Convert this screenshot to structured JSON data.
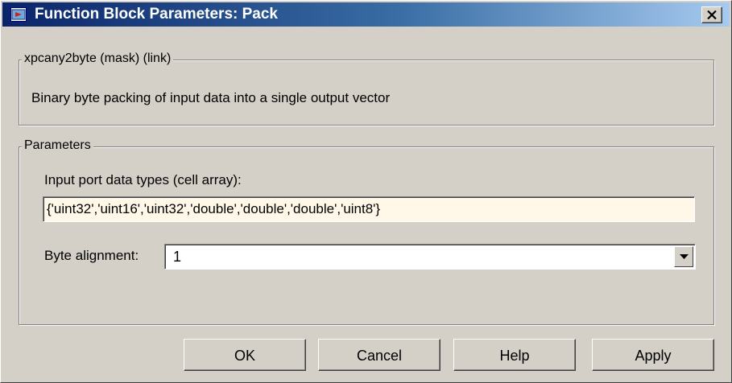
{
  "window": {
    "title": "Function Block Parameters: Pack",
    "close_icon": "close-icon",
    "app_icon": "simulink-block-icon"
  },
  "description_group": {
    "legend": "xpcany2byte (mask) (link)",
    "text": "Binary byte packing of input data into a single output vector"
  },
  "parameters_group": {
    "legend": "Parameters",
    "input_port_label": "Input port data types (cell array):",
    "input_port_value": "{'uint32','uint16','uint32','double','double','double','uint8'}",
    "byte_alignment_label": "Byte alignment:",
    "byte_alignment_value": "1"
  },
  "buttons": {
    "ok": "OK",
    "cancel": "Cancel",
    "help": "Help",
    "apply": "Apply"
  }
}
